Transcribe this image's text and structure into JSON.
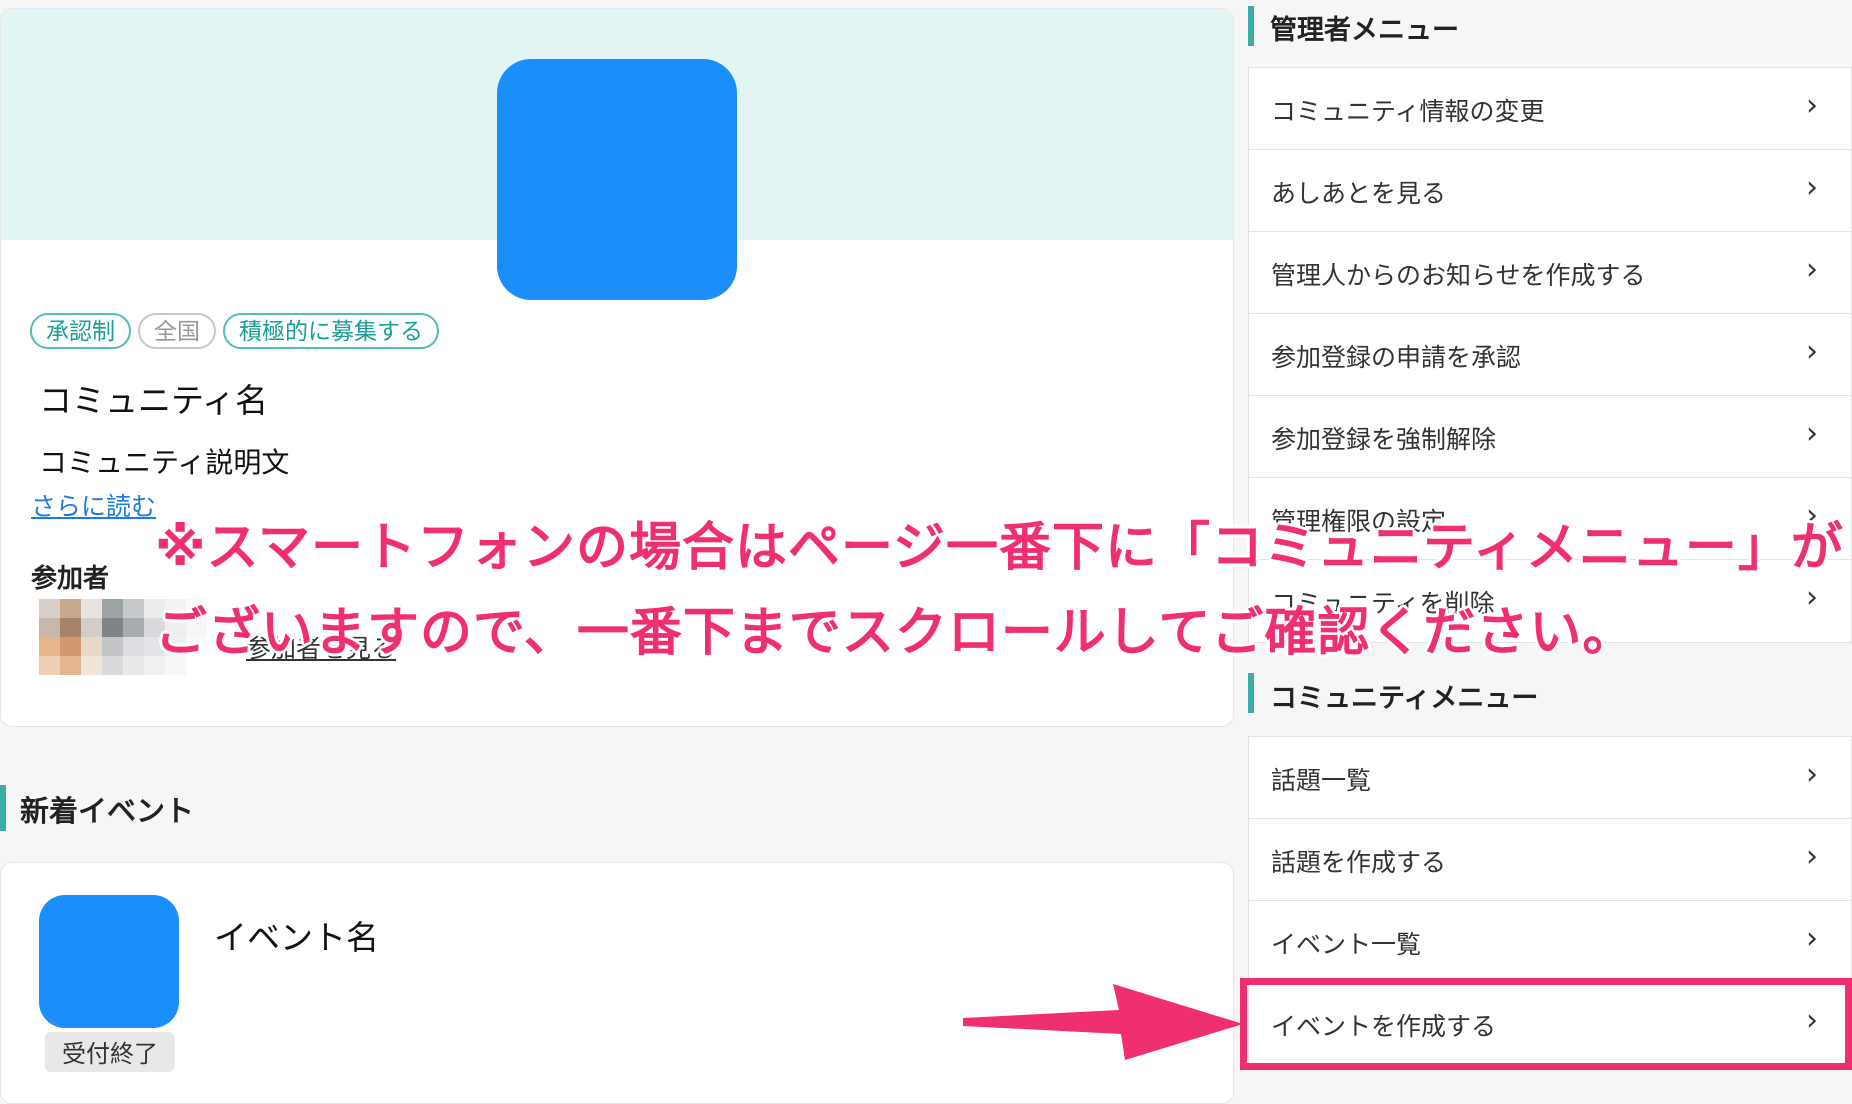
{
  "community": {
    "tags": [
      "承認制",
      "全国",
      "積極的に募集する"
    ],
    "name": "コミュニティ名",
    "description": "コミュニティ説明文",
    "read_more": "さらに読む",
    "members_label": "参加者",
    "members_link": "参加者を見る"
  },
  "events_section": {
    "title": "新着イベント",
    "event": {
      "name": "イベント名",
      "status": "受付終了"
    }
  },
  "admin_menu": {
    "title": "管理者メニュー",
    "items": [
      "コミュニティ情報の変更",
      "あしあとを見る",
      "管理人からのお知らせを作成する",
      "参加登録の申請を承認",
      "参加登録を強制解除",
      "管理権限の設定",
      "コミュニティを削除"
    ]
  },
  "community_menu": {
    "title": "コミュニティメニュー",
    "items": [
      "話題一覧",
      "話題を作成する",
      "イベント一覧",
      "イベントを作成する"
    ]
  },
  "annotation": {
    "line1": "※スマートフォンの場合はページ一番下に「コミュニティメニュー」が",
    "line2": "ございますので、一番下までスクロールしてご確認ください。"
  },
  "colors": {
    "accent": "#3aaea6",
    "brand_blue": "#1a8efc",
    "annotation": "#f0306e",
    "banner": "#e3f4f4"
  },
  "icons": {
    "menu_chevron": "chevron-right-icon",
    "pointer": "arrow-right-icon"
  }
}
